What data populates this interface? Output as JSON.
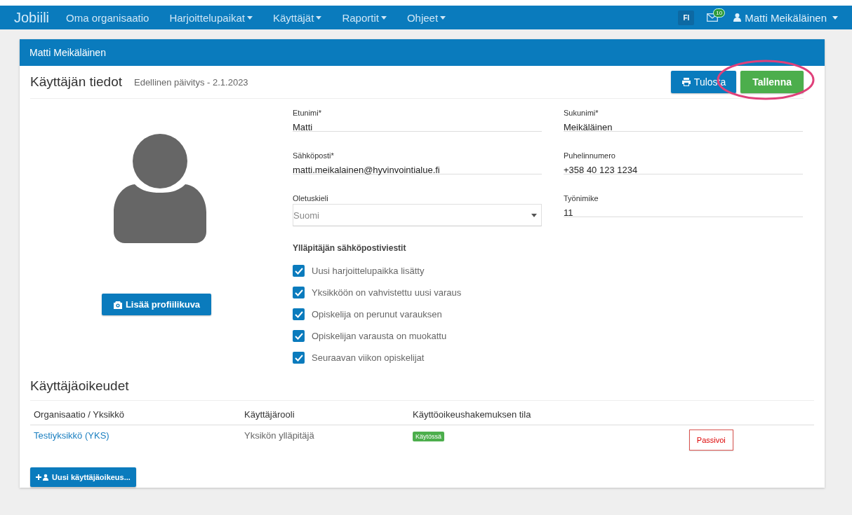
{
  "navbar": {
    "brand": "Jobiili",
    "items": [
      {
        "label": "Oma organisaatio",
        "dropdown": false
      },
      {
        "label": "Harjoittelupaikat",
        "dropdown": true
      },
      {
        "label": "Käyttäjät",
        "dropdown": true
      },
      {
        "label": "Raportit",
        "dropdown": true
      },
      {
        "label": "Ohjeet",
        "dropdown": true
      }
    ],
    "language": "FI",
    "messages_badge": "10",
    "user": "Matti Meikäläinen"
  },
  "panel": {
    "title": "Matti Meikäläinen",
    "heading": "Käyttäjän tiedot",
    "last_updated": "Edellinen päivitys - 2.1.2023",
    "buttons": [
      {
        "label": "Tulosta",
        "kind": "print"
      },
      {
        "label": "Tallenna",
        "kind": "save"
      }
    ],
    "profile_button": "Lisää profiilikuva",
    "fields": [
      {
        "label": "Etunimi*",
        "value": "Matti",
        "kind": "text"
      },
      {
        "label": "Sukunimi*",
        "value": "Meikäläinen",
        "kind": "text"
      },
      {
        "label": "Sähköposti*",
        "value": "matti.meikalainen@hyvinvointialue.fi",
        "kind": "text"
      },
      {
        "label": "Puhelinnumero",
        "value": "+358 40 123 1234",
        "kind": "text"
      },
      {
        "label": "Oletuskieli",
        "value": "Suomi",
        "kind": "select"
      },
      {
        "label": "Työnimike",
        "value": "11",
        "kind": "text"
      }
    ],
    "notifications": {
      "title": "Ylläpitäjän sähköpostiviestit",
      "items": [
        {
          "label": "Uusi harjoittelupaikka lisätty",
          "checked": true
        },
        {
          "label": "Yksikköön on vahvistettu uusi varaus",
          "checked": true
        },
        {
          "label": "Opiskelija on perunut varauksen",
          "checked": true
        },
        {
          "label": "Opiskelijan varausta on muokattu",
          "checked": true
        },
        {
          "label": "Seuraavan viikon opiskelijat",
          "checked": true
        }
      ]
    }
  },
  "rights": {
    "title": "Käyttäjäoikeudet",
    "columns": [
      "Organisaatio / Yksikkö",
      "Käyttäjärooli",
      "Käyttöoikeushakemuksen tila"
    ],
    "rows": [
      {
        "unit": "Testiyksikkö (YKS)",
        "role": "Yksikön ylläpitäjä",
        "status": "Käytössä",
        "action": "Passivoi"
      }
    ],
    "add_button": "Uusi käyttäjäoikeus..."
  }
}
